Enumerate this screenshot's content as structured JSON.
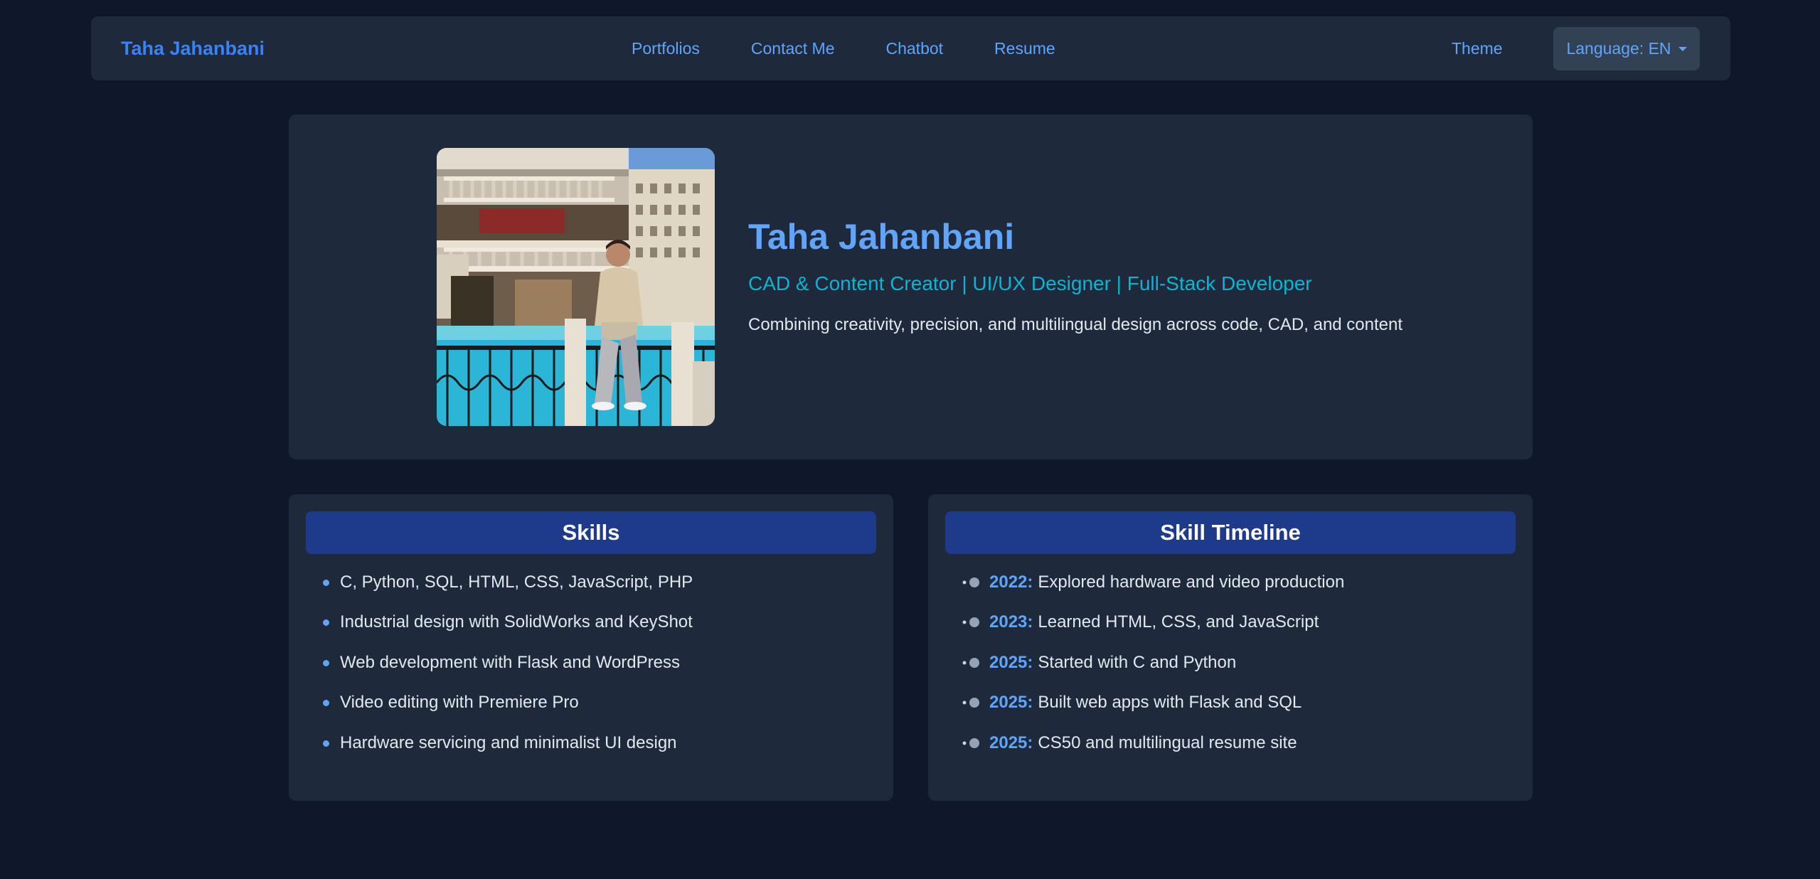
{
  "nav": {
    "brand": "Taha Jahanbani",
    "links": [
      "Portfolios",
      "Contact Me",
      "Chatbot",
      "Resume"
    ],
    "theme": "Theme",
    "language_label": "Language: EN"
  },
  "hero": {
    "name": "Taha Jahanbani",
    "subtitle": "CAD & Content Creator | UI/UX Designer | Full-Stack Developer",
    "description": "Combining creativity, precision, and multilingual design across code, CAD, and content"
  },
  "skills": {
    "title": "Skills",
    "items": [
      "C, Python, SQL, HTML, CSS, JavaScript, PHP",
      "Industrial design with SolidWorks and KeyShot",
      "Web development with Flask and WordPress",
      "Video editing with Premiere Pro",
      "Hardware servicing and minimalist UI design"
    ]
  },
  "timeline": {
    "title": "Skill Timeline",
    "items": [
      {
        "year": "2022:",
        "text": "Explored hardware and video production"
      },
      {
        "year": "2023:",
        "text": "Learned HTML, CSS, and JavaScript"
      },
      {
        "year": "2025:",
        "text": "Started with C and Python"
      },
      {
        "year": "2025:",
        "text": "Built web apps with Flask and SQL"
      },
      {
        "year": "2025:",
        "text": "CS50 and multilingual resume site"
      }
    ]
  },
  "colors": {
    "background": "#0f172a",
    "surface": "#1e293b",
    "accent": "#60a5fa",
    "brand": "#3b82f6",
    "cyan": "#06b6d4",
    "header": "#1e3a8a"
  }
}
